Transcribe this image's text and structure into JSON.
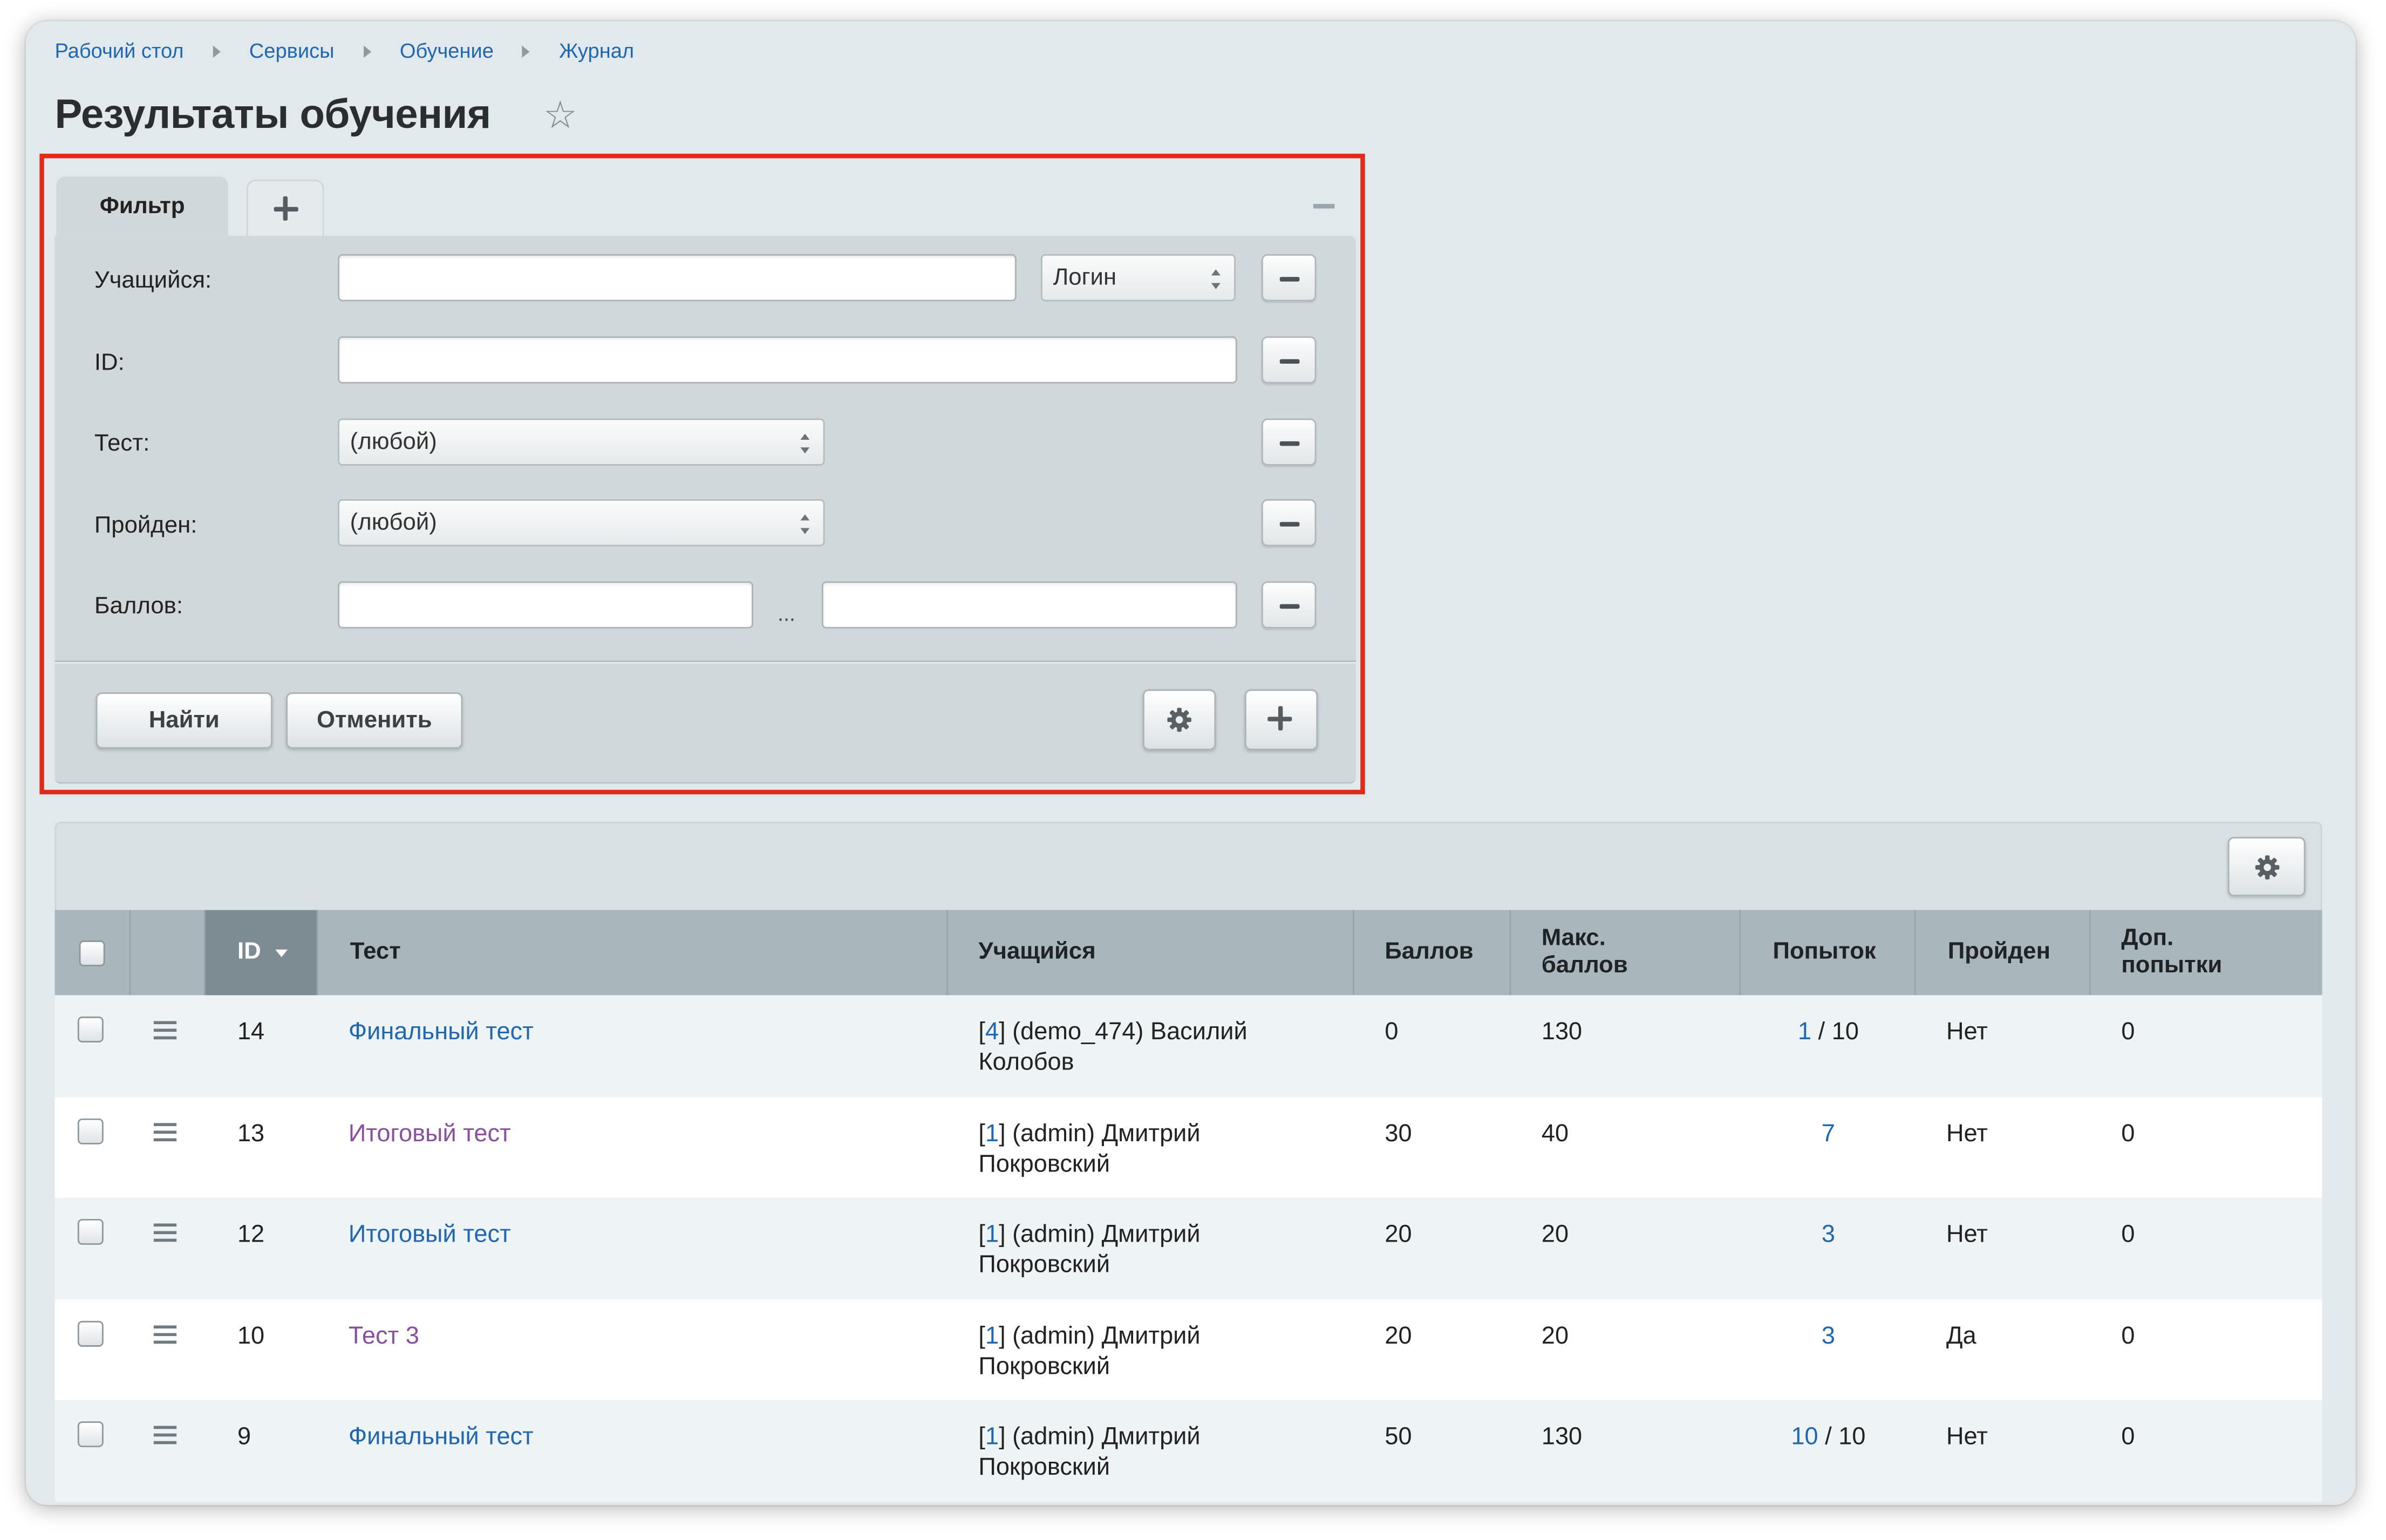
{
  "breadcrumbs": [
    "Рабочий стол",
    "Сервисы",
    "Обучение",
    "Журнал"
  ],
  "page_title": "Результаты обучения",
  "filter": {
    "tab_label": "Фильтр",
    "fields": {
      "student": {
        "label": "Учащийся:",
        "value": "",
        "mode": "Логин"
      },
      "id": {
        "label": "ID:",
        "value": ""
      },
      "test": {
        "label": "Тест:",
        "value": "(любой)"
      },
      "passed": {
        "label": "Пройден:",
        "value": "(любой)"
      },
      "score": {
        "label": "Баллов:",
        "from": "",
        "to": "",
        "separator": "..."
      }
    },
    "find_label": "Найти",
    "cancel_label": "Отменить"
  },
  "table": {
    "columns": {
      "id": "ID",
      "test": "Тест",
      "student": "Учащийся",
      "score": "Баллов",
      "max_score_line1": "Макс.",
      "max_score_line2": "баллов",
      "attempts": "Попыток",
      "passed": "Пройден",
      "extra_line1": "Доп.",
      "extra_line2": "попытки"
    },
    "sort_column": "ID",
    "sort_order": "desc",
    "rows": [
      {
        "id": "14",
        "test": "Финальный тест",
        "test_visited": false,
        "student_id": "4",
        "student_line1": "(demo_474) Василий",
        "student_line2": "Колобов",
        "score": "0",
        "max_score": "130",
        "attempts": "1",
        "attempts_limit": "10",
        "passed": "Нет",
        "extra": "0"
      },
      {
        "id": "13",
        "test": "Итоговый тест",
        "test_visited": true,
        "student_id": "1",
        "student_line1": "(admin) Дмитрий",
        "student_line2": "Покровский",
        "score": "30",
        "max_score": "40",
        "attempts": "7",
        "attempts_limit": "",
        "passed": "Нет",
        "extra": "0"
      },
      {
        "id": "12",
        "test": "Итоговый тест",
        "test_visited": false,
        "student_id": "1",
        "student_line1": "(admin) Дмитрий",
        "student_line2": "Покровский",
        "score": "20",
        "max_score": "20",
        "attempts": "3",
        "attempts_limit": "",
        "passed": "Нет",
        "extra": "0"
      },
      {
        "id": "10",
        "test": "Тест 3",
        "test_visited": true,
        "student_id": "1",
        "student_line1": "(admin) Дмитрий",
        "student_line2": "Покровский",
        "score": "20",
        "max_score": "20",
        "attempts": "3",
        "attempts_limit": "",
        "passed": "Да",
        "extra": "0"
      },
      {
        "id": "9",
        "test": "Финальный тест",
        "test_visited": false,
        "student_id": "1",
        "student_line1": "(admin) Дмитрий",
        "student_line2": "Покровский",
        "score": "50",
        "max_score": "130",
        "attempts": "10",
        "attempts_limit": "10",
        "passed": "Нет",
        "extra": "0"
      }
    ]
  },
  "colors": {
    "link": "#2067b0",
    "visited_link": "#8a4f9e",
    "highlight": "#e22a1b",
    "header_bg": "#a9b6bc",
    "sorted_header_bg": "#7d8c93"
  },
  "icons": [
    "star-icon",
    "plus-icon",
    "minus-icon",
    "gear-icon",
    "menu-icon",
    "sort-desc-icon",
    "chevron-right-icon"
  ]
}
